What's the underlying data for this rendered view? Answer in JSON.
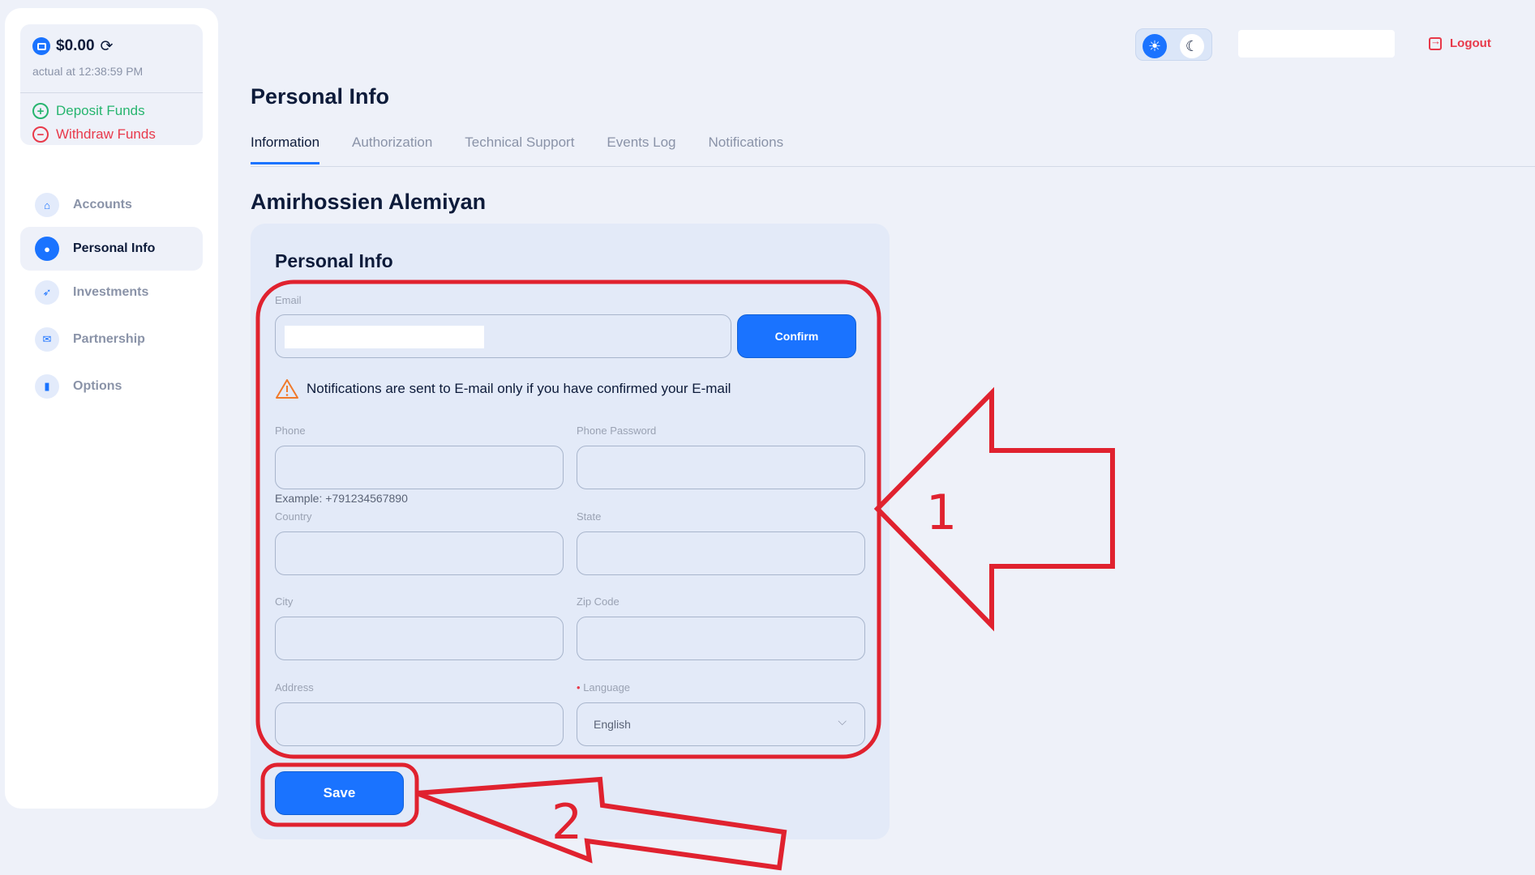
{
  "balance": {
    "amount": "$0.00",
    "actual_time": "actual at 12:38:59 PM",
    "deposit_label": "Deposit Funds",
    "withdraw_label": "Withdraw Funds"
  },
  "sidebar": {
    "items": [
      {
        "label": "Accounts",
        "icon": "home-icon"
      },
      {
        "label": "Personal Info",
        "icon": "user-icon",
        "active": true
      },
      {
        "label": "Investments",
        "icon": "rocket-icon"
      },
      {
        "label": "Partnership",
        "icon": "envelope-icon"
      },
      {
        "label": "Options",
        "icon": "bar-chart-icon"
      }
    ]
  },
  "header": {
    "logout_label": "Logout"
  },
  "page": {
    "title": "Personal Info",
    "tabs": [
      "Information",
      "Authorization",
      "Technical Support",
      "Events Log",
      "Notifications"
    ],
    "active_tab": "Information",
    "user_name": "Amirhossien Alemiyan"
  },
  "form": {
    "title": "Personal Info",
    "email_label": "Email",
    "email_value": "",
    "confirm_label": "Confirm",
    "notice": "Notifications are sent to E-mail only if you have confirmed your E-mail",
    "phone_label": "Phone",
    "phone_password_label": "Phone Password",
    "phone_example": "Example: +791234567890",
    "country_label": "Country",
    "state_label": "State",
    "city_label": "City",
    "zip_label": "Zip Code",
    "address_label": "Address",
    "language_label": "Language",
    "language_required_mark": "•",
    "language_value": "English",
    "save_label": "Save"
  },
  "annotations": {
    "label_1": "1",
    "label_2": "2",
    "color": "#e0222f"
  },
  "colors": {
    "accent": "#1a73ff",
    "deposit": "#27b56f",
    "withdraw": "#e8394a",
    "background": "#eef1f9"
  }
}
